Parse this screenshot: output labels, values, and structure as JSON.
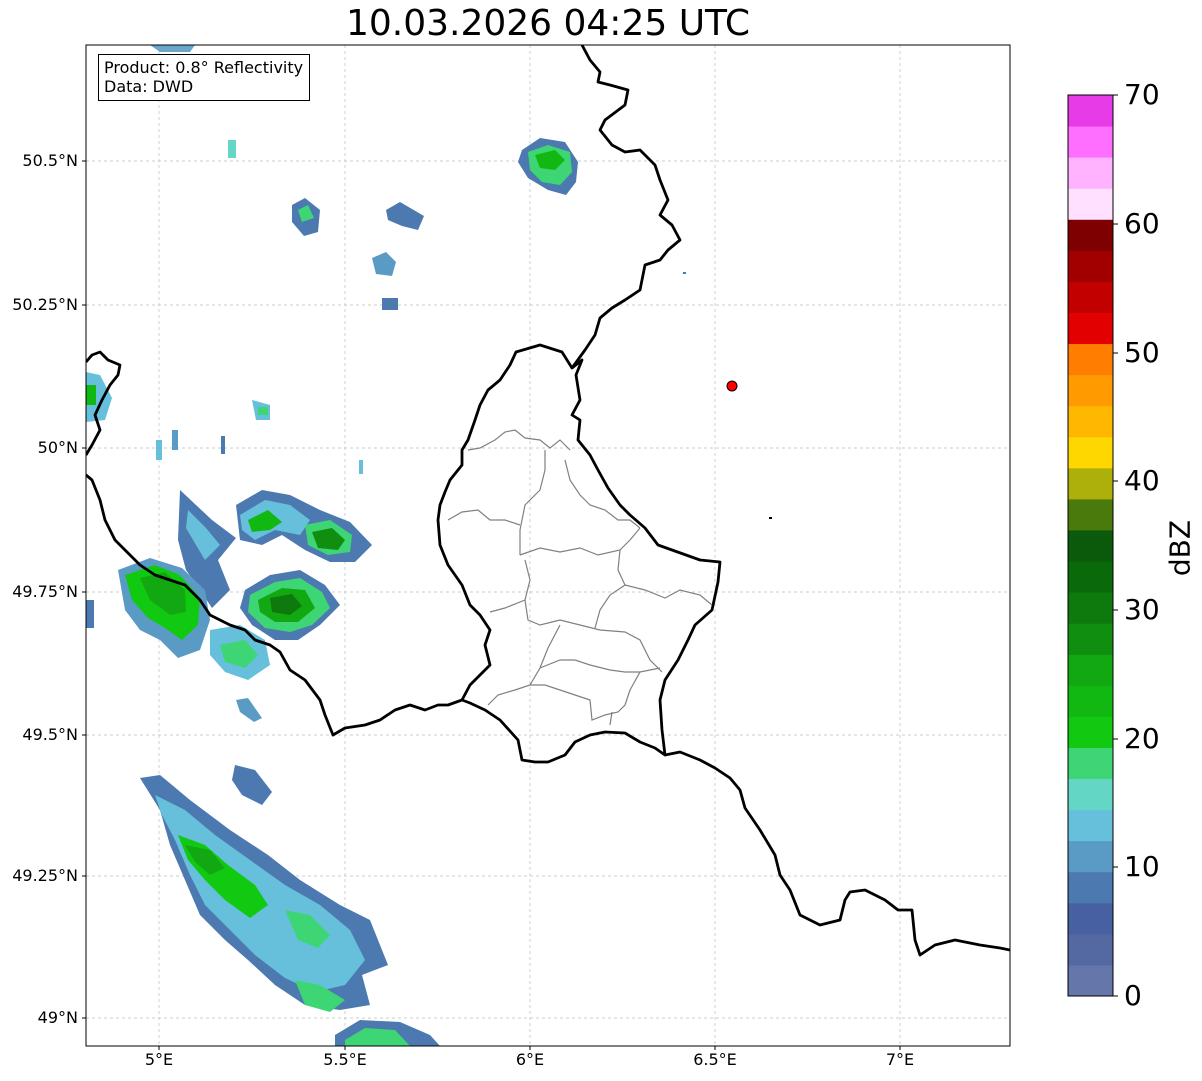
{
  "title": "10.03.2026 04:25 UTC",
  "info_box": {
    "product": "Product: 0.8° Reflectivity",
    "source": "Data: DWD"
  },
  "axes": {
    "lon_ticks": [
      "5°E",
      "5.5°E",
      "6°E",
      "6.5°E",
      "7°E"
    ],
    "lat_ticks": [
      "50.5°N",
      "50.25°N",
      "50°N",
      "49.75°N",
      "49.5°N",
      "49.25°N",
      "49°N"
    ],
    "lon_range": [
      4.8,
      7.3
    ],
    "lat_range": [
      48.95,
      50.7
    ]
  },
  "colorbar": {
    "label": "dBZ",
    "ticks": [
      "0",
      "10",
      "20",
      "30",
      "40",
      "50",
      "60",
      "70"
    ],
    "range": [
      0,
      70
    ],
    "colors": [
      "#6576aa",
      "#5468a2",
      "#4760a2",
      "#4c79b0",
      "#5a9bc6",
      "#66c0dc",
      "#64d6c6",
      "#3ed675",
      "#12c912",
      "#12b812",
      "#12a812",
      "#108e10",
      "#0e7a0e",
      "#0a6a0a",
      "#0b5a0b",
      "#4a7a0b",
      "#adb00b",
      "#ffd700",
      "#ffb700",
      "#ff9a00",
      "#ff7d00",
      "#e30000",
      "#c20000",
      "#a20000",
      "#7e0000",
      "#ffe0ff",
      "#ffb3ff",
      "#ff6fff",
      "#e63be6"
    ]
  },
  "marker": {
    "lon": 6.55,
    "lat": 50.11,
    "color": "#ff0000"
  },
  "colors": {
    "border": "#000000",
    "district": "#808080",
    "grid": "#bdbdbd"
  }
}
